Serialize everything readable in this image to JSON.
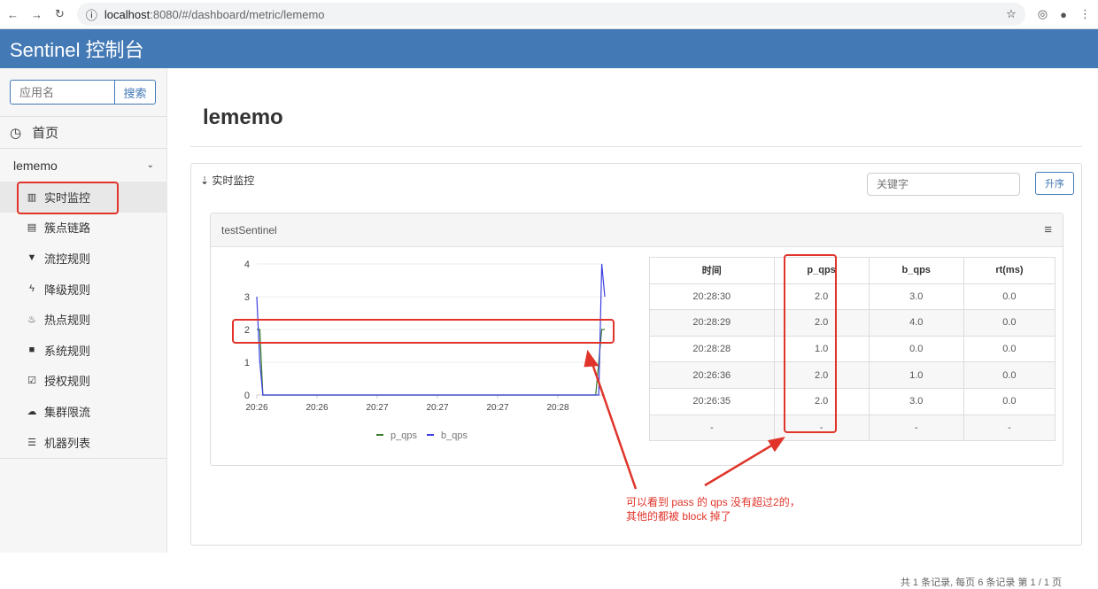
{
  "browser": {
    "url_host": "localhost",
    "url_path": ":8080/#/dashboard/metric/lememo"
  },
  "header": {
    "title": "Sentinel 控制台"
  },
  "sidebar": {
    "search_placeholder": "应用名",
    "search_button": "搜索",
    "home": "首页",
    "app": "lememo",
    "items": [
      {
        "label": "实时监控",
        "icon": "bar-chart-icon"
      },
      {
        "label": "簇点链路",
        "icon": "list-icon"
      },
      {
        "label": "流控规则",
        "icon": "filter-icon"
      },
      {
        "label": "降级规则",
        "icon": "bolt-icon"
      },
      {
        "label": "热点规则",
        "icon": "fire-icon"
      },
      {
        "label": "系统规则",
        "icon": "lock-icon"
      },
      {
        "label": "授权规则",
        "icon": "check-square-icon"
      },
      {
        "label": "集群限流",
        "icon": "cloud-icon"
      },
      {
        "label": "机器列表",
        "icon": "th-list-icon"
      }
    ]
  },
  "main": {
    "title": "lememo",
    "panel_title": "实时监控",
    "keyword_placeholder": "关键字",
    "sort_button": "升序",
    "resource": "testSentinel",
    "table": {
      "headers": [
        "时间",
        "p_qps",
        "b_qps",
        "rt(ms)"
      ],
      "rows": [
        [
          "20:28:30",
          "2.0",
          "3.0",
          "0.0"
        ],
        [
          "20:28:29",
          "2.0",
          "4.0",
          "0.0"
        ],
        [
          "20:28:28",
          "1.0",
          "0.0",
          "0.0"
        ],
        [
          "20:26:36",
          "2.0",
          "1.0",
          "0.0"
        ],
        [
          "20:26:35",
          "2.0",
          "3.0",
          "0.0"
        ],
        [
          "-",
          "-",
          "-",
          "-"
        ]
      ]
    },
    "pager": "共 1 条记录, 每页 6 条记录 第 1 / 1 页"
  },
  "annotation": {
    "line1": "可以看到 pass 的 qps 没有超过2的，",
    "line2": "其他的都被 block 掉了"
  },
  "colors": {
    "header": "#4379b5",
    "p_qps": "#3a7d2c",
    "b_qps": "#3b3fe0",
    "annotation": "#e0342a"
  },
  "chart_data": {
    "type": "line",
    "x_start": "20:26:35",
    "x_end": "20:28:30",
    "xticks": [
      "20:26",
      "20:26",
      "20:27",
      "20:27",
      "20:27",
      "20:28"
    ],
    "yticks": [
      0,
      1,
      2,
      3,
      4
    ],
    "ylim": [
      0,
      4
    ],
    "legend": "bottom",
    "x_seconds": [
      0,
      1,
      2,
      111,
      112,
      113,
      114,
      115
    ],
    "series": [
      {
        "name": "p_qps",
        "values": [
          2,
          2,
          0,
          0,
          0,
          1,
          2,
          2
        ]
      },
      {
        "name": "b_qps",
        "values": [
          3,
          1,
          0,
          0,
          0,
          0,
          4,
          3
        ]
      }
    ]
  }
}
